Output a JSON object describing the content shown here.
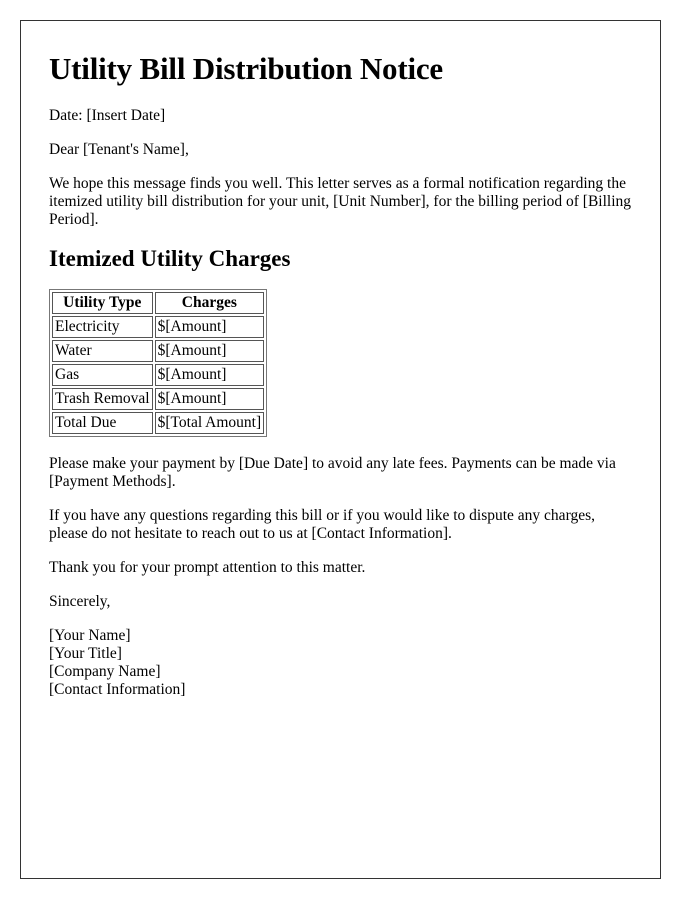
{
  "document": {
    "title": "Utility Bill Distribution Notice",
    "date_line": "Date: [Insert Date]",
    "salutation": "Dear [Tenant's Name],",
    "intro": "We hope this message finds you well. This letter serves as a formal notification regarding the itemized utility bill distribution for your unit, [Unit Number], for the billing period of [Billing Period].",
    "section_heading": "Itemized Utility Charges",
    "table": {
      "headers": [
        "Utility Type",
        "Charges"
      ],
      "rows": [
        [
          "Electricity",
          "$[Amount]"
        ],
        [
          "Water",
          "$[Amount]"
        ],
        [
          "Gas",
          "$[Amount]"
        ],
        [
          "Trash Removal",
          "$[Amount]"
        ],
        [
          "Total Due",
          "$[Total Amount]"
        ]
      ]
    },
    "payment_paragraph": "Please make your payment by [Due Date] to avoid any late fees. Payments can be made via [Payment Methods].",
    "questions_paragraph": "If you have any questions regarding this bill or if you would like to dispute any charges, please do not hesitate to reach out to us at [Contact Information].",
    "thanks_paragraph": "Thank you for your prompt attention to this matter.",
    "closing": "Sincerely,",
    "signature": [
      "[Your Name]",
      "[Your Title]",
      "[Company Name]",
      "[Contact Information]"
    ]
  }
}
